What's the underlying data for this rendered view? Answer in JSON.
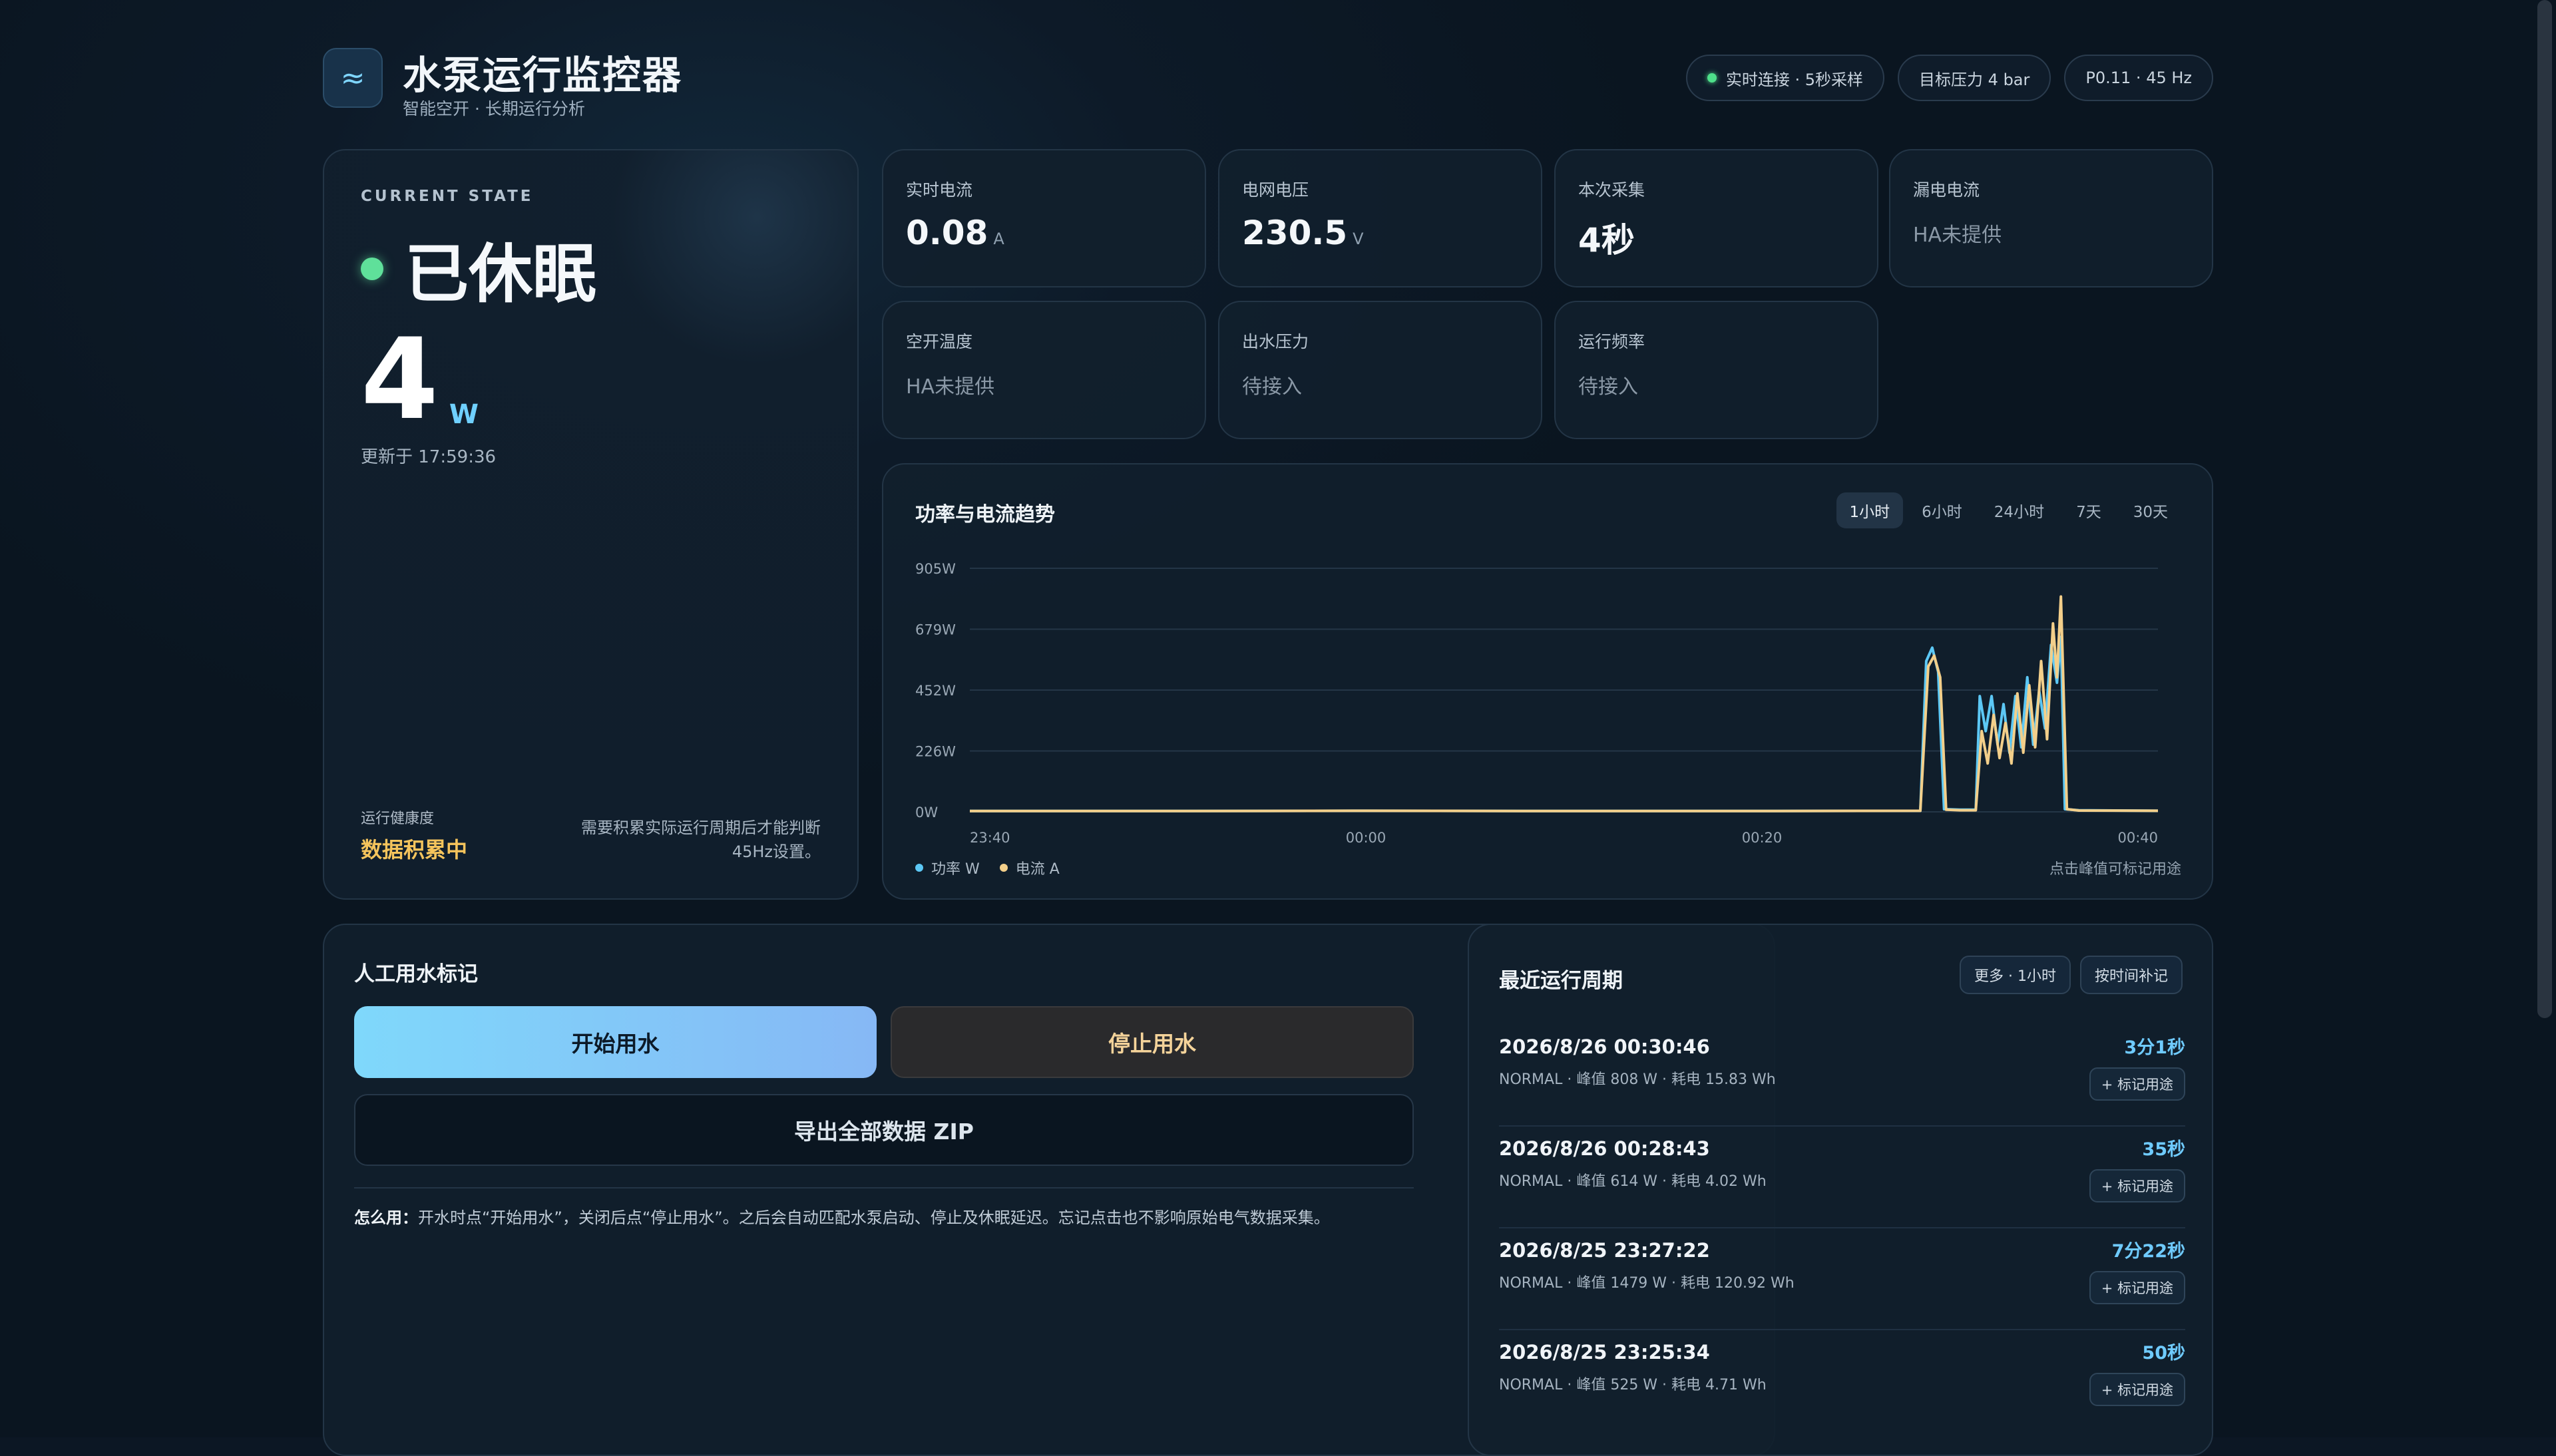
{
  "header": {
    "logo_icon": "≈",
    "title": "水泵运行监控器",
    "subtitle": "智能空开 · 长期运行分析",
    "chips": [
      "实时连接 · 5秒采样",
      "目标压力 4 bar",
      "P0.11 · 45 Hz"
    ]
  },
  "state": {
    "eyebrow": "CURRENT STATE",
    "status": "已休眠",
    "power_value": "4",
    "power_unit": "W",
    "updated": "更新于 17:59:36",
    "health_label": "运行健康度",
    "health_value": "数据积累中",
    "health_note": "需要积累实际运行周期后才能判断45Hz设置。"
  },
  "metrics": [
    {
      "label": "实时电流",
      "value": "0.08",
      "unit": "A"
    },
    {
      "label": "电网电压",
      "value": "230.5",
      "unit": "V"
    },
    {
      "label": "本次采集",
      "value": "4秒",
      "unit": ""
    },
    {
      "label": "漏电电流",
      "muted": "HA未提供"
    },
    {
      "label": "空开温度",
      "muted": "HA未提供"
    },
    {
      "label": "出水压力",
      "muted": "待接入"
    },
    {
      "label": "运行频率",
      "muted": "待接入"
    }
  ],
  "chart": {
    "title": "功率与电流趋势",
    "ranges": [
      "1小时",
      "6小时",
      "24小时",
      "7天",
      "30天"
    ],
    "active_range": "1小时",
    "legend_power": "功率 W",
    "legend_current": "电流 A",
    "hint": "点击峰值可标记用途"
  },
  "chart_data": {
    "type": "line",
    "y_ticks": [
      "905W",
      "679W",
      "452W",
      "226W",
      "0W"
    ],
    "x_ticks": [
      "23:40",
      "00:00",
      "00:20",
      "00:40"
    ],
    "ylim": [
      0,
      905
    ],
    "x_minutes_range": [
      0,
      60
    ],
    "series": [
      {
        "name": "功率 W",
        "color": "#5cc8f5",
        "points": [
          [
            0,
            3
          ],
          [
            10,
            3
          ],
          [
            20,
            4
          ],
          [
            30,
            3
          ],
          [
            40,
            3
          ],
          [
            48,
            4
          ],
          [
            48.3,
            560
          ],
          [
            48.6,
            610
          ],
          [
            48.9,
            520
          ],
          [
            49.2,
            10
          ],
          [
            50,
            8
          ],
          [
            50.8,
            8
          ],
          [
            51,
            430
          ],
          [
            51.3,
            300
          ],
          [
            51.6,
            430
          ],
          [
            51.9,
            250
          ],
          [
            52.2,
            400
          ],
          [
            52.5,
            220
          ],
          [
            52.8,
            430
          ],
          [
            53.1,
            240
          ],
          [
            53.4,
            500
          ],
          [
            53.7,
            250
          ],
          [
            54,
            450
          ],
          [
            54.3,
            310
          ],
          [
            54.6,
            620
          ],
          [
            54.9,
            480
          ],
          [
            55.1,
            650
          ],
          [
            55.3,
            10
          ],
          [
            56,
            6
          ],
          [
            60,
            4
          ]
        ]
      },
      {
        "name": "电流 A",
        "color": "#f3cf8a",
        "points": [
          [
            0,
            3
          ],
          [
            10,
            3
          ],
          [
            20,
            4
          ],
          [
            30,
            3
          ],
          [
            40,
            3
          ],
          [
            48,
            4
          ],
          [
            48.4,
            540
          ],
          [
            48.7,
            580
          ],
          [
            49,
            500
          ],
          [
            49.3,
            8
          ],
          [
            50,
            6
          ],
          [
            50.8,
            6
          ],
          [
            51.1,
            300
          ],
          [
            51.4,
            180
          ],
          [
            51.7,
            360
          ],
          [
            52,
            200
          ],
          [
            52.3,
            330
          ],
          [
            52.6,
            180
          ],
          [
            52.9,
            440
          ],
          [
            53.2,
            220
          ],
          [
            53.5,
            470
          ],
          [
            53.8,
            240
          ],
          [
            54.1,
            560
          ],
          [
            54.4,
            270
          ],
          [
            54.7,
            700
          ],
          [
            54.9,
            500
          ],
          [
            55.1,
            800
          ],
          [
            55.4,
            10
          ],
          [
            56,
            5
          ],
          [
            60,
            4
          ]
        ]
      }
    ]
  },
  "manual": {
    "title": "人工用水标记",
    "start_label": "开始用水",
    "stop_label": "停止用水",
    "export_label": "导出全部数据 ZIP",
    "howto_prefix": "怎么用：",
    "howto_text": "开水时点“开始用水”，关闭后点“停止用水”。之后会自动匹配水泵启动、停止及休眠延迟。忘记点击也不影响原始电气数据采集。"
  },
  "cycles": {
    "title": "最近运行周期",
    "more_label": "更多 · 1小时",
    "backfill_label": "按时间补记",
    "tag_label": "+ 标记用途",
    "items": [
      {
        "time": "2026/8/26 00:30:46",
        "meta": "NORMAL · 峰值 808 W · 耗电 15.83 Wh",
        "duration": "3分1秒"
      },
      {
        "time": "2026/8/26 00:28:43",
        "meta": "NORMAL · 峰值 614 W · 耗电 4.02 Wh",
        "duration": "35秒"
      },
      {
        "time": "2026/8/25 23:27:22",
        "meta": "NORMAL · 峰值 1479 W · 耗电 120.92 Wh",
        "duration": "7分22秒"
      },
      {
        "time": "2026/8/25 23:25:34",
        "meta": "NORMAL · 峰值 525 W · 耗电 4.71 Wh",
        "duration": "50秒"
      }
    ]
  }
}
